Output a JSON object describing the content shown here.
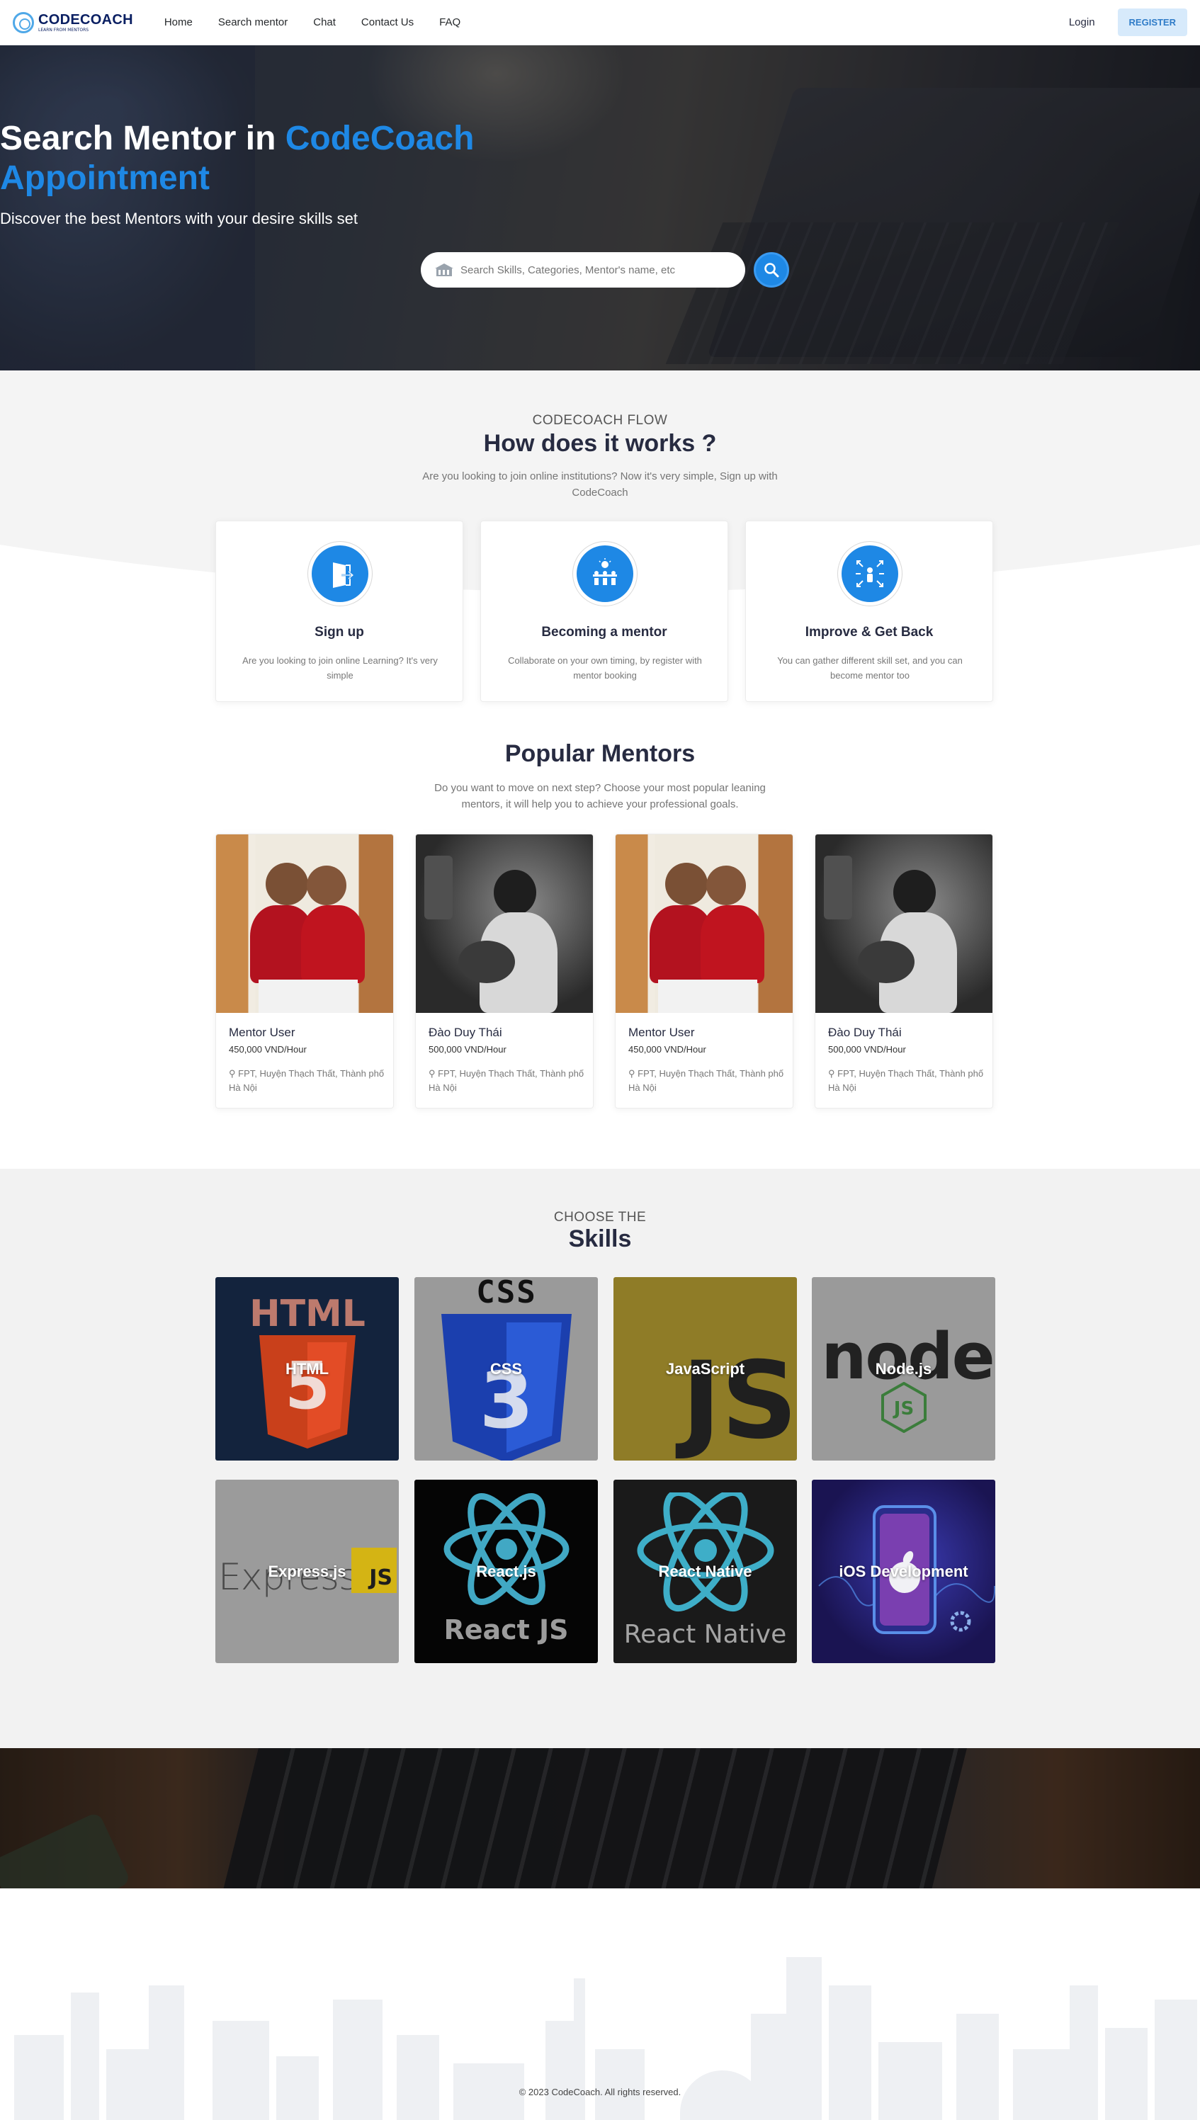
{
  "nav": {
    "logo_text": "CODECOACH",
    "logo_sub": "LEARN FROM MENTORS",
    "links": [
      "Home",
      "Search mentor",
      "Chat",
      "Contact Us",
      "FAQ"
    ],
    "login": "Login",
    "register": "REGISTER"
  },
  "hero": {
    "title_plain": "Search Mentor in ",
    "title_accent_1": "CodeCoach",
    "title_accent_2": "Appointment",
    "subtitle": "Discover the best Mentors with your desire skills set",
    "search_placeholder": "Search Skills, Categories, Mentor's name, etc",
    "search_icon": "magnifier-icon"
  },
  "flow": {
    "eyebrow": "CODECOACH FLOW",
    "title": "How does it works ?",
    "description": "Are you looking to join online institutions? Now it's very simple, Sign up with CodeCoach",
    "cards": [
      {
        "title": "Sign up",
        "desc": "Are you looking to join online Learning? It's very simple",
        "icon": "door-enter-icon"
      },
      {
        "title": "Becoming a mentor",
        "desc": "Collaborate on your own timing, by register with mentor booking",
        "icon": "team-idea-icon"
      },
      {
        "title": "Improve & Get Back",
        "desc": "You can gather different skill set, and you can become mentor too",
        "icon": "expand-arrows-icon"
      }
    ]
  },
  "mentors": {
    "title": "Popular Mentors",
    "description": "Do you want to move on next step? Choose your most popular leaning mentors, it will help you to achieve your professional goals.",
    "items": [
      {
        "name": "Mentor User",
        "price": "450,000 VND/Hour",
        "location": "FPT, Huyện Thạch Thất, Thành phố Hà Nội"
      },
      {
        "name": "Đào Duy Thái",
        "price": "500,000 VND/Hour",
        "location": "FPT, Huyện Thạch Thất, Thành phố Hà Nội"
      },
      {
        "name": "Mentor User",
        "price": "450,000 VND/Hour",
        "location": "FPT, Huyện Thạch Thất, Thành phố Hà Nội"
      },
      {
        "name": "Đào Duy Thái",
        "price": "500,000 VND/Hour",
        "location": "FPT, Huyện Thạch Thất, Thành phố Hà Nội"
      }
    ]
  },
  "skills": {
    "eyebrow": "CHOOSE THE",
    "title": "Skills",
    "items": [
      {
        "label": "HTML",
        "logo_text": "HTML",
        "badge": "5"
      },
      {
        "label": "CSS",
        "logo_text": "CSS",
        "badge": "3"
      },
      {
        "label": "JavaScript",
        "badge": "JS"
      },
      {
        "label": "Node.js",
        "logo_text": "node"
      },
      {
        "label": "Express.js",
        "logo_text": "Express",
        "badge": "JS"
      },
      {
        "label": "React.js",
        "logo_text": "React JS"
      },
      {
        "label": "React Native",
        "logo_text": "React Native"
      },
      {
        "label": "iOS Development"
      }
    ],
    "colors": {
      "html_bg": "#13233d",
      "css_bg": "#9a9a9a",
      "js_bg": "#8f7c27",
      "node_bg": "#9a9a9a",
      "express_bg": "#9b9b9b",
      "react_bg": "#050505",
      "rn_bg": "#1a1a1a",
      "ios_bg": "#1a1452"
    }
  },
  "footer": {
    "copyright": "© 2023 CodeCoach. All rights reserved."
  },
  "colors": {
    "accent": "#1e88e5",
    "navy": "#0a1f62",
    "register_bg": "#d7eafb"
  }
}
